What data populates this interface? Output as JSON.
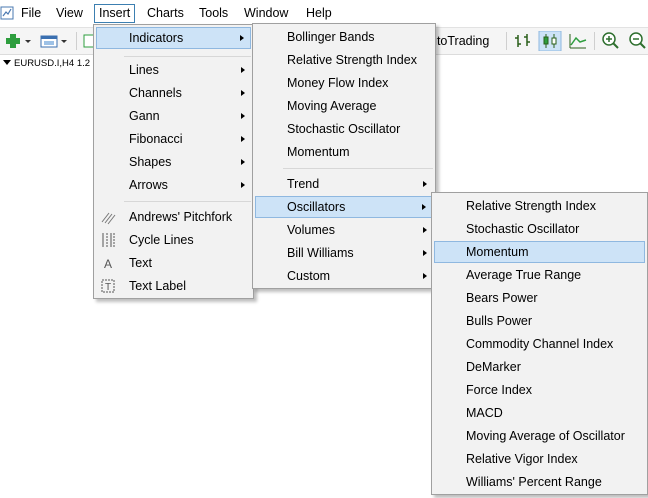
{
  "menubar": {
    "items": [
      "File",
      "View",
      "Insert",
      "Charts",
      "Tools",
      "Window",
      "Help"
    ]
  },
  "toolbar": {
    "autotrading_label": "utoTrading"
  },
  "chart_tab": {
    "label": "EURUSD.I,H4",
    "extra": "1.2"
  },
  "insert_menu": {
    "items": [
      {
        "label": "Indicators",
        "icon": null,
        "submenu": true
      },
      {
        "label": "Lines",
        "icon": null,
        "submenu": true
      },
      {
        "label": "Channels",
        "icon": null,
        "submenu": true
      },
      {
        "label": "Gann",
        "icon": null,
        "submenu": true
      },
      {
        "label": "Fibonacci",
        "icon": null,
        "submenu": true
      },
      {
        "label": "Shapes",
        "icon": null,
        "submenu": true
      },
      {
        "label": "Arrows",
        "icon": null,
        "submenu": true
      },
      {
        "label": "Andrews' Pitchfork",
        "icon": "pitchfork-icon",
        "submenu": false
      },
      {
        "label": "Cycle Lines",
        "icon": "cycle-lines-icon",
        "submenu": false
      },
      {
        "label": "Text",
        "icon": "text-icon",
        "submenu": false
      },
      {
        "label": "Text Label",
        "icon": "text-label-icon",
        "submenu": false
      }
    ]
  },
  "indicators_menu": {
    "items": [
      {
        "label": "Bollinger Bands",
        "submenu": false
      },
      {
        "label": "Relative Strength Index",
        "submenu": false
      },
      {
        "label": "Money Flow Index",
        "submenu": false
      },
      {
        "label": "Moving Average",
        "submenu": false
      },
      {
        "label": "Stochastic Oscillator",
        "submenu": false
      },
      {
        "label": "Momentum",
        "submenu": false
      },
      {
        "label": "Trend",
        "submenu": true
      },
      {
        "label": "Oscillators",
        "submenu": true
      },
      {
        "label": "Volumes",
        "submenu": true
      },
      {
        "label": "Bill Williams",
        "submenu": true
      },
      {
        "label": "Custom",
        "submenu": true
      }
    ]
  },
  "oscillators_menu": {
    "items": [
      "Relative Strength Index",
      "Stochastic Oscillator",
      "Momentum",
      "Average True Range",
      "Bears Power",
      "Bulls Power",
      "Commodity Channel Index",
      "DeMarker",
      "Force Index",
      "MACD",
      "Moving Average of Oscillator",
      "Relative Vigor Index",
      "Williams' Percent Range"
    ]
  },
  "colors": {
    "highlight_bg": "#cde3f7",
    "highlight_border": "#8fb8e0",
    "menu_bg": "#f2f2f2",
    "toolbar_icon_green": "#2e9e3e"
  }
}
